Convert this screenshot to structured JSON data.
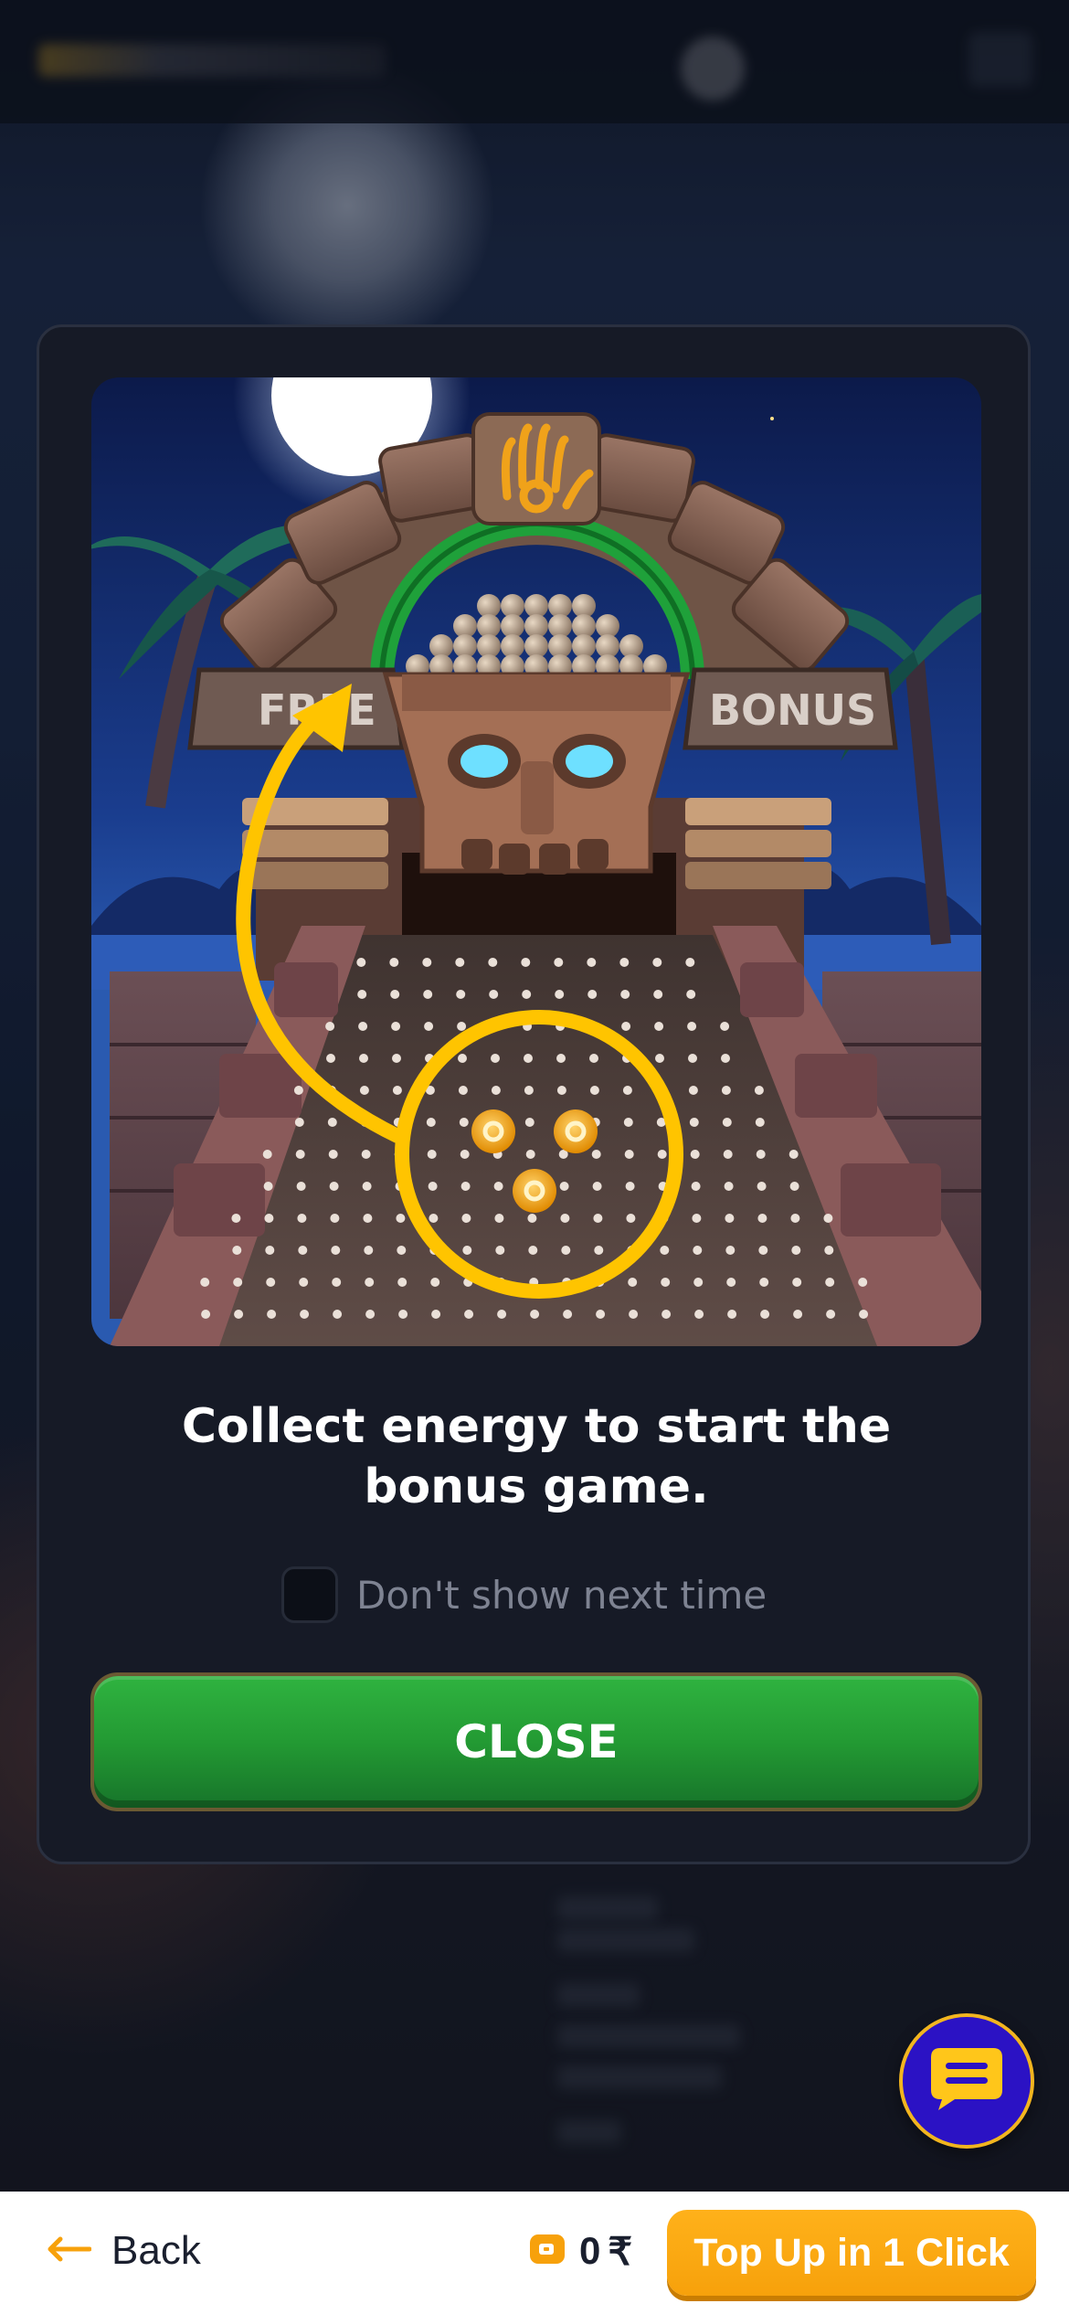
{
  "modal": {
    "message": "Collect energy to start the bonus game.",
    "checkbox_label": "Don't show next time",
    "checkbox_checked": false,
    "close_label": "CLOSE",
    "art_signs": {
      "left": "FREE",
      "right": "BONUS"
    }
  },
  "bottom_bar": {
    "back_label": "Back",
    "balance_amount": "0",
    "currency": "₹",
    "topup_label": "Top Up in 1 Click"
  },
  "colors": {
    "close_button": "#239a33",
    "topup_button": "#f7a10b",
    "chat_button": "#2b12c4",
    "highlight": "#ffc400"
  },
  "icons": {
    "back": "arrow-left-icon",
    "wallet": "wallet-icon",
    "chat": "chat-icon"
  }
}
